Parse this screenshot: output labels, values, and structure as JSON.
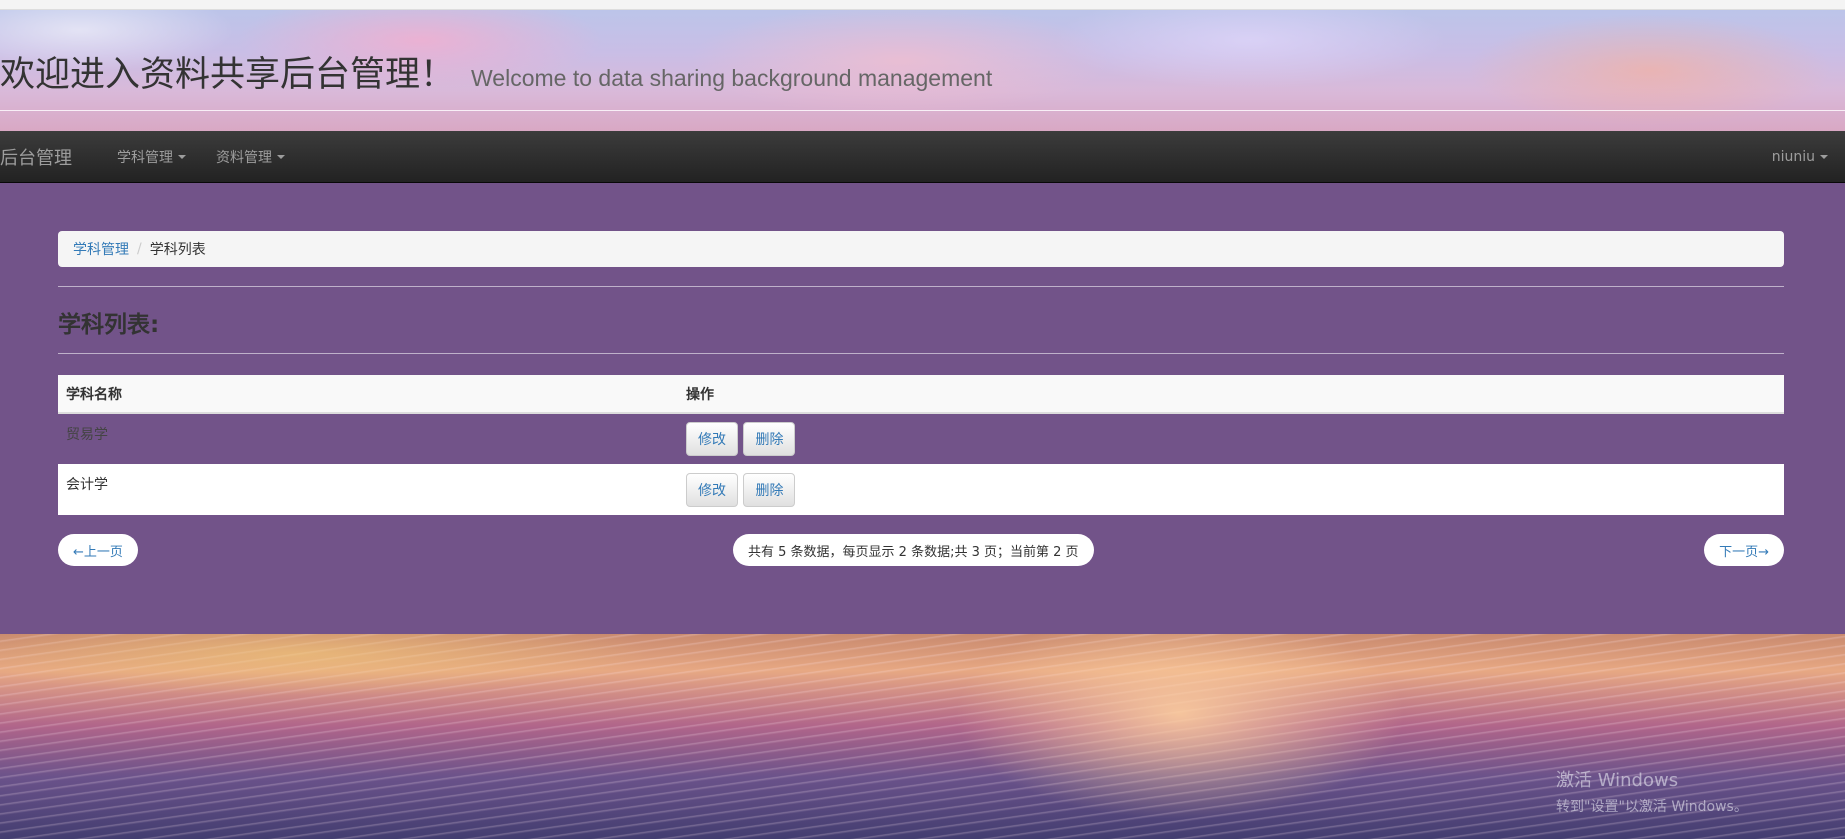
{
  "header": {
    "title_cn": "欢迎进入资料共享后台管理！",
    "title_en": "Welcome to data sharing background management"
  },
  "navbar": {
    "brand": "后台管理",
    "items": [
      {
        "label": "学科管理"
      },
      {
        "label": "资料管理"
      }
    ],
    "user": "niuniu"
  },
  "breadcrumb": {
    "parent": "学科管理",
    "separator": "/",
    "current": "学科列表"
  },
  "page": {
    "section_title": "学科列表:"
  },
  "table": {
    "headers": [
      "学科名称",
      "操作"
    ],
    "rows": [
      {
        "name": "贸易学",
        "edit": "修改",
        "delete": "删除"
      },
      {
        "name": "会计学",
        "edit": "修改",
        "delete": "删除"
      }
    ]
  },
  "pagination": {
    "prev": "←上一页",
    "info": "共有 5 条数据，每页显示 2 条数据;共 3 页；当前第 2 页",
    "next": "下一页→"
  },
  "watermark": {
    "line1": "激活 Windows",
    "line2": "转到\"设置\"以激活 Windows。"
  },
  "colors": {
    "panel": "#725389",
    "navbar": "#222222",
    "link": "#337ab7"
  }
}
